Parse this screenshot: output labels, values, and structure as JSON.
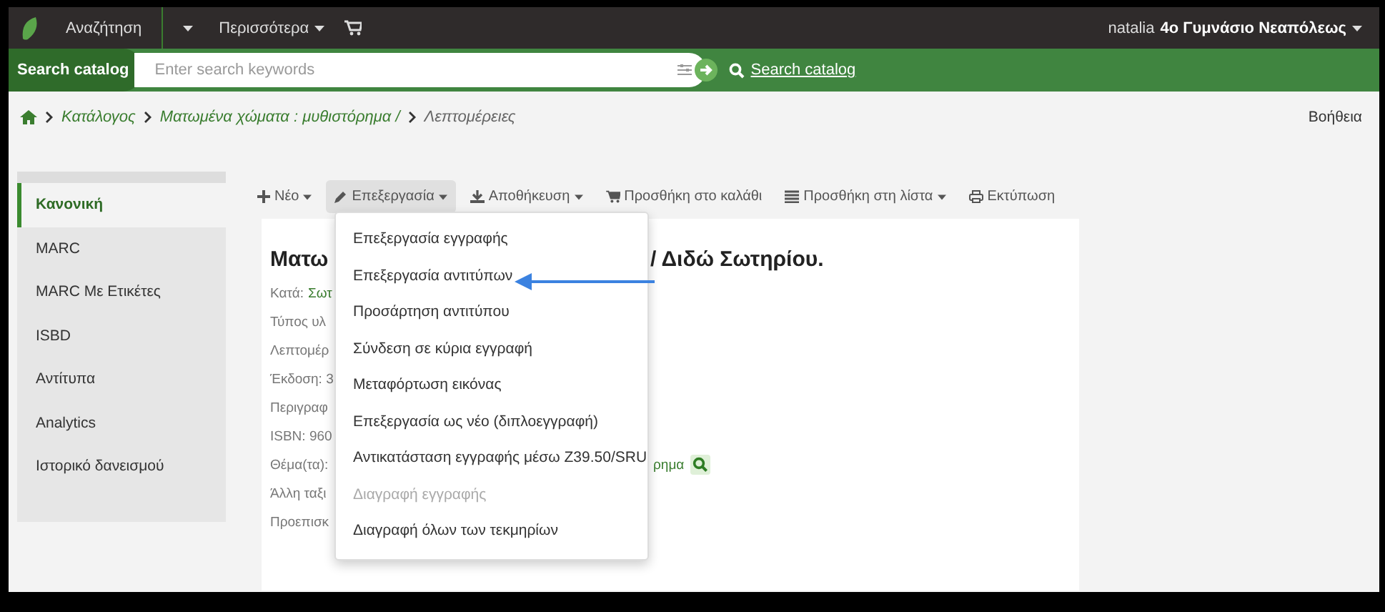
{
  "top_nav": {
    "items": [
      {
        "label": "Αναζήτηση",
        "caret": false
      },
      {
        "label": "Περισσότερα",
        "caret": true
      }
    ],
    "user": "natalia",
    "library": "4ο Γυμνάσιο Νεαπόλεως"
  },
  "search_bar": {
    "label": "Search catalog",
    "placeholder": "Enter search keywords",
    "submit": "Search catalog"
  },
  "breadcrumb": [
    {
      "label": "Κατάλογος",
      "link": true
    },
    {
      "label": "Ματωμένα χώματα : μυθιστόρημα /",
      "link": true
    },
    {
      "label": "Λεπτομέρειες",
      "link": false
    }
  ],
  "help": "Βοήθεια",
  "sidebar": {
    "items": [
      {
        "label": "Κανονική",
        "selected": true
      },
      {
        "label": "MARC",
        "selected": false
      },
      {
        "label": "MARC Με Ετικέτες",
        "selected": false
      },
      {
        "label": "ISBD",
        "selected": false
      },
      {
        "label": "Αντίτυπα",
        "selected": false
      },
      {
        "label": "Analytics",
        "selected": false
      },
      {
        "label": "Ιστορικό δανεισμού",
        "selected": false
      }
    ]
  },
  "toolbar": [
    {
      "label": "Νέο",
      "caret": true,
      "selected": false
    },
    {
      "label": "Επεξεργασία",
      "caret": true,
      "selected": true
    },
    {
      "label": "Αποθήκευση",
      "caret": true,
      "selected": false
    },
    {
      "label": "Προσθήκη στο καλάθι",
      "caret": false,
      "selected": false
    },
    {
      "label": "Προσθήκη στη λίστα",
      "caret": true,
      "selected": false
    },
    {
      "label": "Εκτύπωση",
      "caret": false,
      "selected": false
    }
  ],
  "edit_menu": [
    {
      "label": "Επεξεργασία εγγραφής",
      "disabled": false
    },
    {
      "label": "Επεξεργασία αντιτύπων",
      "disabled": false
    },
    {
      "label": "Προσάρτηση αντιτύπου",
      "disabled": false
    },
    {
      "label": "Σύνδεση σε κύρια εγγραφή",
      "disabled": false
    },
    {
      "label": "Μεταφόρτωση εικόνας",
      "disabled": false
    },
    {
      "label": "Επεξεργασία ως νέο (διπλοεγγραφή)",
      "disabled": false
    },
    {
      "label": "Αντικατάσταση εγγραφής μέσω Z39.50/SRU",
      "disabled": false
    },
    {
      "label": "Διαγραφή εγγραφής",
      "disabled": true
    },
    {
      "label": "Διαγραφή όλων των τεκμηρίων",
      "disabled": false
    }
  ],
  "record": {
    "title_start": "Ματω",
    "title_end": "/ Διδώ Σωτηρίου.",
    "fields": [
      {
        "label": "Κατά:",
        "value": "Σωτ"
      },
      {
        "label": "Τύπος υλ"
      },
      {
        "label": "Λεπτομέρ"
      },
      {
        "label": "Έκδοση: 3"
      },
      {
        "label": "Περιγραφ"
      },
      {
        "label": "ISBN: 960"
      },
      {
        "label": "Θέμα(τα):",
        "trailing": "ρημα"
      },
      {
        "label": "Άλλη ταξι"
      },
      {
        "label": "Προεπισκ"
      }
    ]
  }
}
